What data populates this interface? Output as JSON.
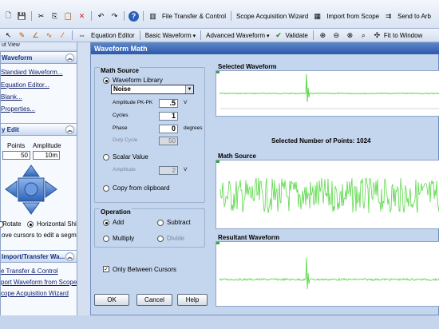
{
  "toolbar": {
    "file_transfer": "File Transfer & Control",
    "scope_wizard": "Scope Acquisition Wizard",
    "import_scope": "Import from Scope",
    "send_arb": "Send to Arb",
    "equation_editor": "Equation Editor",
    "basic_waveform": "Basic Waveform",
    "advanced_waveform": "Advanced Waveform",
    "validate": "Validate",
    "fit_window": "Fit to Window"
  },
  "left": {
    "header": "ut View",
    "waveform_section": {
      "title": "Waveform",
      "links": [
        "Standard Waveform...",
        "Equation Editor...",
        "Blank...",
        "Properties..."
      ]
    },
    "edit_section": {
      "title": "y Edit",
      "col_points": "Points",
      "col_amplitude": "Amplitude",
      "points_value": "50",
      "amplitude_value": "10m",
      "rotate_label": "Rotate",
      "horizontal_label": "Horizontal Shi",
      "hint": "ove cursors to edit a segme"
    },
    "import_section": {
      "title": "Import/Transfer Wa...",
      "links": [
        "e Transfer & Control",
        "port  Waveform from Scope",
        "cope Acquisition Wizard"
      ]
    }
  },
  "dialog": {
    "title": "Waveform Math",
    "math_source": {
      "title": "Math Source",
      "library_label": "Waveform Library",
      "library_value": "Noise",
      "amp_label": "Amplitude PK-PK",
      "amp_value": ".5",
      "amp_unit": "V",
      "cycles_label": "Cycles",
      "cycles_value": "1",
      "phase_label": "Phase",
      "phase_value": "0",
      "phase_unit": "degrees",
      "duty_label": "Duty Cycle",
      "duty_value": "50",
      "scalar_label": "Scalar Value",
      "scalar_amp_label": "Amplitude",
      "scalar_amp_value": "2",
      "scalar_amp_unit": "V",
      "clipboard_label": "Copy from clipboard"
    },
    "operation": {
      "title": "Operation",
      "add": "Add",
      "subtract": "Subtract",
      "multiply": "Multiply",
      "divide": "Divide"
    },
    "only_between_cursors": "Only Between Cursors",
    "buttons": {
      "ok": "OK",
      "cancel": "Cancel",
      "help": "Help"
    },
    "selected_waveform": {
      "title": "Selected Waveform",
      "points_label": "Selected Number of Points: 1024"
    },
    "math_source_plot": {
      "title": "Math Source"
    },
    "resultant": {
      "title": "Resultant Waveform"
    }
  },
  "colors": {
    "trace": "#5cd84a",
    "title_bar": "#2c57a8"
  }
}
